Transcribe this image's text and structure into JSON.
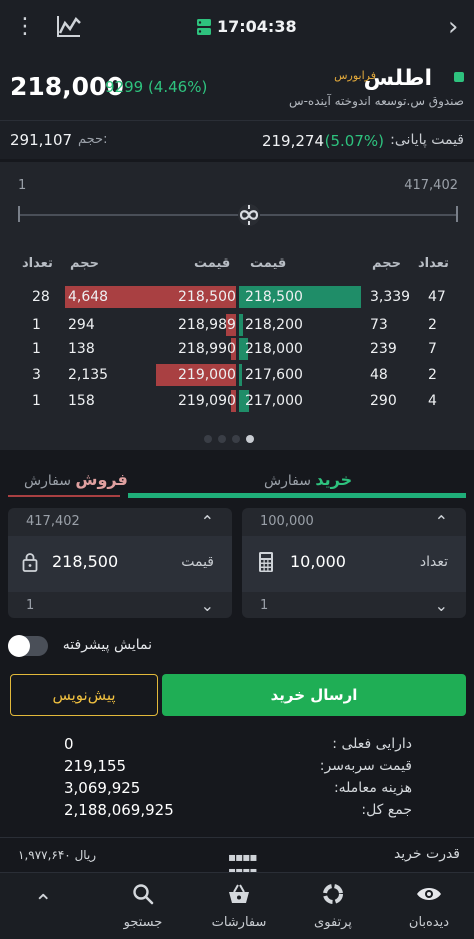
{
  "topbar": {
    "time": "17:04:38"
  },
  "header": {
    "price": "218,000",
    "change": "9299 (4.46%)",
    "symbol": "اطلس",
    "market": "فرابورس",
    "fullname": "صندوق س.توسعه اندوخته آینده-س"
  },
  "stats": {
    "volume_label": "حجم:",
    "volume": "291,107",
    "final_label": "قیمت پایانی:",
    "final_pct": "(5.07%)",
    "final_value": "219,274"
  },
  "depth": {
    "range_min": "1",
    "range_max": "417,402",
    "headers": {
      "count": "تعداد",
      "volume": "حجم",
      "price": "قیمت"
    },
    "rows": [
      {
        "sell_count": "28",
        "sell_vol": "4,648",
        "sell_price": "218,500",
        "buy_price": "218,500",
        "buy_vol": "3,339",
        "buy_count": "47",
        "sell_share": 0.98,
        "buy_share": 0.98
      },
      {
        "sell_count": "1",
        "sell_vol": "294",
        "sell_price": "218,989",
        "buy_price": "218,200",
        "buy_vol": "73",
        "buy_count": "2",
        "sell_share": 0.06,
        "buy_share": 0.03
      },
      {
        "sell_count": "1",
        "sell_vol": "138",
        "sell_price": "218,990",
        "buy_price": "218,000",
        "buy_vol": "239",
        "buy_count": "7",
        "sell_share": 0.03,
        "buy_share": 0.07
      },
      {
        "sell_count": "3",
        "sell_vol": "2,135",
        "sell_price": "219,000",
        "buy_price": "217,600",
        "buy_vol": "48",
        "buy_count": "2",
        "sell_share": 0.46,
        "buy_share": 0.02
      },
      {
        "sell_count": "1",
        "sell_vol": "158",
        "sell_price": "219,090",
        "buy_price": "217,000",
        "buy_vol": "290",
        "buy_count": "4",
        "sell_share": 0.03,
        "buy_share": 0.08
      }
    ]
  },
  "order": {
    "tab_sell_small": "سفارش",
    "tab_sell_bold": "فروش",
    "tab_buy_small": "سفارش",
    "tab_buy_bold": "خرید",
    "price_limit": "417,402",
    "price_value": "218,500",
    "price_label": "قیمت",
    "price_step": "1",
    "qty_limit": "100,000",
    "qty_value": "10,000",
    "qty_label": "تعداد",
    "qty_step": "1",
    "advanced_label": "نمایش پیشرفته",
    "preorder_label": "پیش‌نویس",
    "submit_label": "ارسال خرید"
  },
  "summary": [
    {
      "label": "دارایی فعلی :",
      "value": "0"
    },
    {
      "label": "قیمت سربه‌سر:",
      "value": "219,155"
    },
    {
      "label": "هزینه معامله:",
      "value": "3,069,925"
    },
    {
      "label": "جمع کل:",
      "value": "2,188,069,925"
    }
  ],
  "power": {
    "label": "قدرت خرید",
    "value": "۱,۹۷۷,۶۴۰ ریال"
  },
  "nav": {
    "watch": "دیده‌بان",
    "portfolio": "پرتفوی",
    "orders": "سفارشات",
    "search": "جستجو"
  },
  "colors": {
    "buy": "#1fae55",
    "sell": "#a94042",
    "accent": "#e2b93b"
  }
}
